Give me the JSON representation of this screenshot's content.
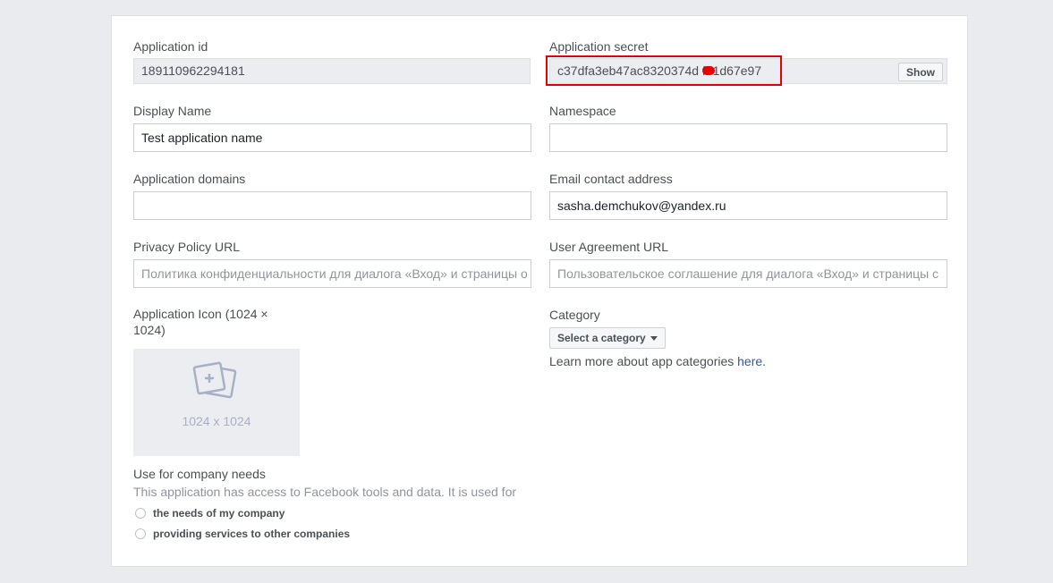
{
  "app_id": {
    "label": "Application id",
    "value": "189110962294181"
  },
  "app_secret": {
    "label": "Application secret",
    "value": "c37dfa3eb47ac8320374d  fe1d67e97",
    "show_button": "Show"
  },
  "display_name": {
    "label": "Display Name",
    "value": "Test application name"
  },
  "namespace": {
    "label": "Namespace",
    "value": ""
  },
  "app_domains": {
    "label": "Application domains",
    "value": ""
  },
  "email": {
    "label": "Email contact address",
    "value": "sasha.demchukov@yandex.ru"
  },
  "privacy_url": {
    "label": "Privacy Policy URL",
    "placeholder": "Политика конфиденциальности для диалога «Вход» и страницы о"
  },
  "user_agreement_url": {
    "label": "User Agreement URL",
    "placeholder": "Пользовательское соглашение для диалога «Вход» и страницы с"
  },
  "app_icon": {
    "label_line1": "Application Icon (1024 ×",
    "label_line2": "1024)",
    "size_text": "1024 x 1024"
  },
  "category": {
    "label": "Category",
    "button": "Select a category",
    "learn_text": "Learn more about app categories ",
    "learn_link": "here",
    "learn_suffix": "."
  },
  "company_use": {
    "label": "Use for company needs",
    "description": "This application has access to Facebook tools and data. It is used for",
    "options": [
      "the needs of my company",
      "providing services to other companies"
    ]
  },
  "colors": {
    "highlight": "#e60000",
    "link": "#365899",
    "background": "#e9ebee"
  }
}
